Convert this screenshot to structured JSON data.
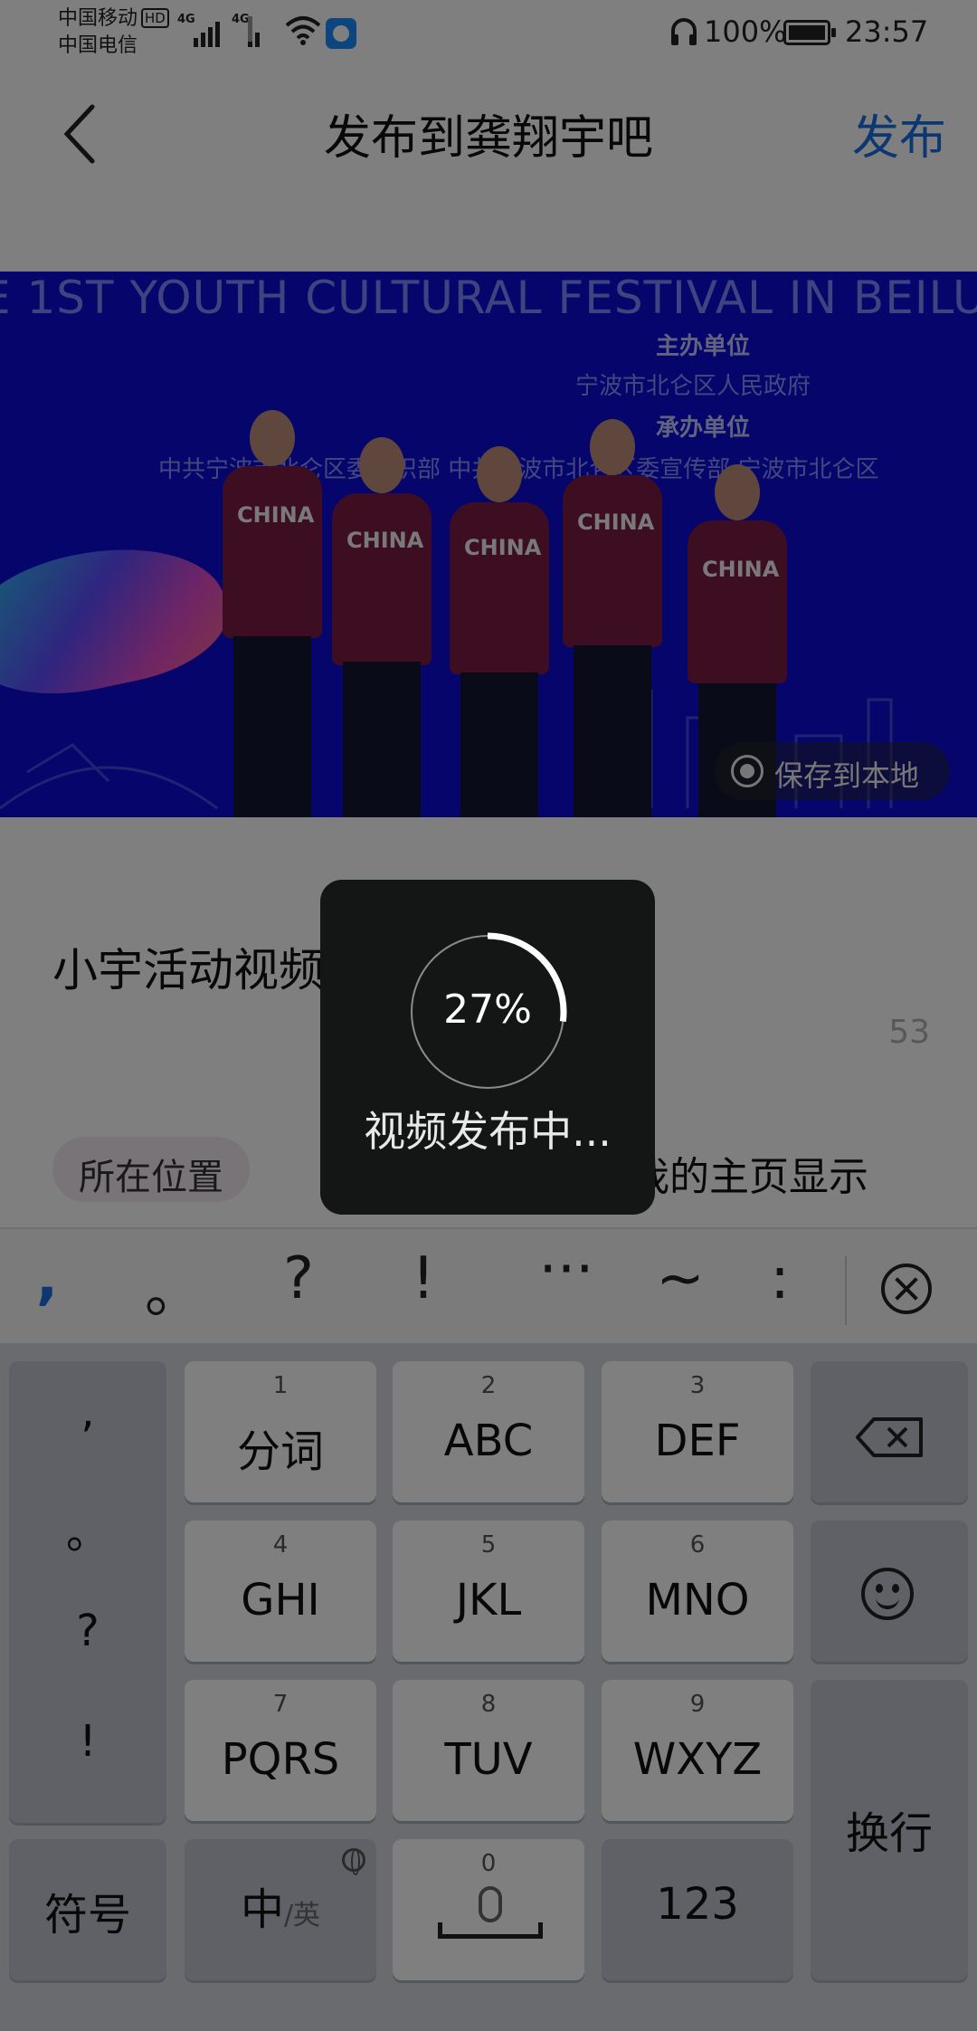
{
  "status_bar": {
    "carrier1": "中国移动",
    "hd": "HD",
    "carrier2": "中国电信",
    "net1": "4G",
    "net2": "4G",
    "battery": "100%",
    "time": "23:57",
    "icons": [
      "signal-icon",
      "wifi-icon",
      "app-notification-icon",
      "headset-icon",
      "battery-icon"
    ]
  },
  "header": {
    "title": "发布到龚翔宇吧",
    "publish_label": "发布"
  },
  "video": {
    "banner_text": "E 1ST YOUTH CULTURAL FESTIVAL IN BEILU",
    "sponsor_heading": "主办单位",
    "sponsor_name": "宁波市北仑区人民政府",
    "organizer_heading": "承办单位",
    "organizer_names": "中共宁波市北仑区委组织部   中共宁波市北仑区委宣传部   宁波市北仑区",
    "jersey_text": "CHINA",
    "save_label": "保存到本地"
  },
  "post": {
    "text": "小宇活动视频 ~",
    "remaining_count": "53",
    "location_label": "所在位置",
    "show_on_home_label": "在我的主页显示",
    "show_on_home_checked": true
  },
  "punctuation_bar": [
    ",",
    "。",
    "?",
    "!",
    "···",
    "~",
    ":"
  ],
  "keyboard": {
    "side_punct": [
      ",",
      "。",
      "?",
      "!"
    ],
    "keys": [
      {
        "num": "1",
        "label": "分词"
      },
      {
        "num": "2",
        "label": "ABC"
      },
      {
        "num": "3",
        "label": "DEF"
      },
      {
        "num": "4",
        "label": "GHI"
      },
      {
        "num": "5",
        "label": "JKL"
      },
      {
        "num": "6",
        "label": "MNO"
      },
      {
        "num": "7",
        "label": "PQRS"
      },
      {
        "num": "8",
        "label": "TUV"
      },
      {
        "num": "9",
        "label": "WXYZ"
      }
    ],
    "symbol_label": "符号",
    "lang_main": "中",
    "lang_alt": "/英",
    "space_num": "0",
    "num_label": "123",
    "enter_label": "换行"
  },
  "upload_toast": {
    "progress_text": "27%",
    "progress": 0.27,
    "message": "视频发布中..."
  },
  "colors": {
    "accent": "#1a6fe0",
    "toast_bg": "#141615",
    "video_bg": "#0a0ad6"
  }
}
